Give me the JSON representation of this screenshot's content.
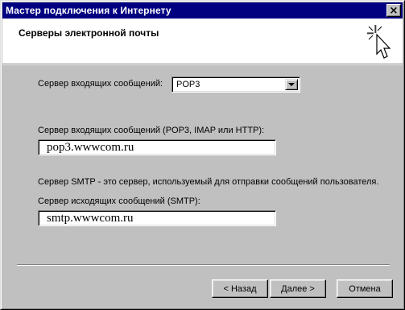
{
  "window": {
    "title": "Мастер подключения к Интернету",
    "close_glyph": "×"
  },
  "header": {
    "title": "Серверы электронной почты",
    "icon": "wizard-sparkle-cursor-icon"
  },
  "incoming_type": {
    "label": "Сервер входящих сообщений:",
    "value": "POP3"
  },
  "incoming_server": {
    "label": "Сервер входящих сообщений (POP3, IMAP или HTTP):",
    "value": "pop3.wwwcom.ru"
  },
  "smtp_note": "Сервер SMTP - это сервер, используемый для отправки сообщений  пользователя.",
  "outgoing_server": {
    "label": "Сервер исходящих сообщений (SMTP):",
    "value": "smtp.wwwcom.ru"
  },
  "buttons": {
    "back": "< Назад",
    "next": "Далее >",
    "cancel": "Отмена"
  },
  "colors": {
    "titlebar": "#000080",
    "face": "#c0c0c0",
    "header_bg": "#ffffff"
  }
}
